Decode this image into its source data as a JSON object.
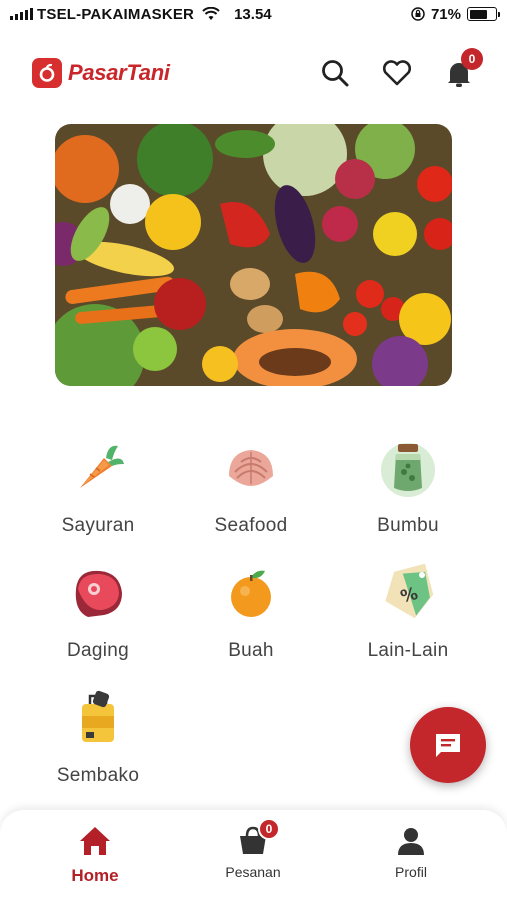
{
  "status_bar": {
    "carrier": "TSEL-PAKAIMASKER",
    "time": "13.54",
    "battery": "71%",
    "battery_level": 0.71
  },
  "header": {
    "logo_text": "PasarTani",
    "notification_count": "0",
    "icons": [
      "search-icon",
      "heart-icon",
      "bell-icon"
    ]
  },
  "banner": {
    "subject": "fresh vegetables and fruits photo"
  },
  "categories": [
    {
      "label": "Sayuran",
      "icon": "carrot-icon"
    },
    {
      "label": "Seafood",
      "icon": "shell-icon"
    },
    {
      "label": "Bumbu",
      "icon": "spice-jar-icon"
    },
    {
      "label": "Daging",
      "icon": "meat-icon"
    },
    {
      "label": "Buah",
      "icon": "orange-icon"
    },
    {
      "label": "Lain-Lain",
      "icon": "discount-tag-icon"
    },
    {
      "label": "Sembako",
      "icon": "grocery-bag-icon"
    }
  ],
  "fab": {
    "icon": "chat-icon"
  },
  "bottom_nav": {
    "items": [
      {
        "label": "Home",
        "icon": "home-icon",
        "active": true
      },
      {
        "label": "Pesanan",
        "icon": "cart-icon",
        "badge": "0"
      },
      {
        "label": "Profil",
        "icon": "person-icon"
      }
    ]
  },
  "colors": {
    "brand": "#c3262b",
    "text": "#444444",
    "background": "#ffffff"
  }
}
